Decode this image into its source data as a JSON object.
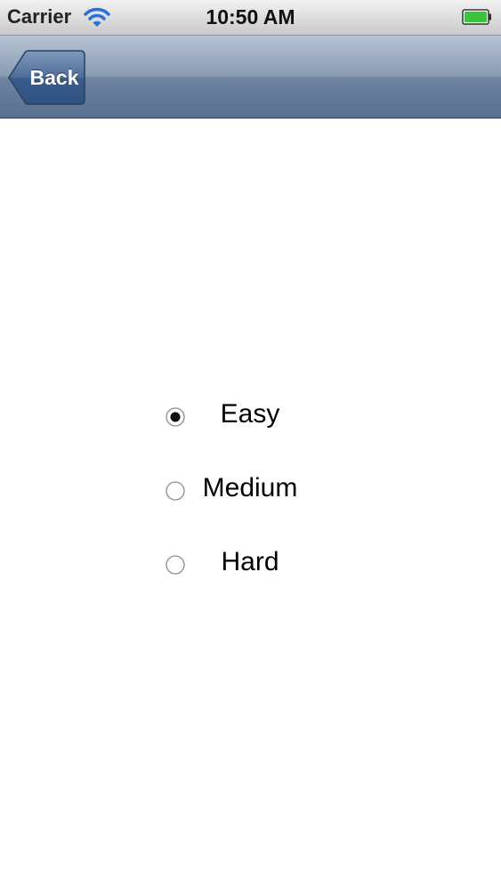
{
  "status_bar": {
    "carrier": "Carrier",
    "time": "10:50 AM",
    "wifi_icon": "wifi-icon",
    "battery_icon": "battery-full-icon",
    "battery_color": "#3cc43c"
  },
  "nav_bar": {
    "back_label": "Back",
    "back_icon": "back-arrow-shape"
  },
  "difficulty": {
    "options": [
      {
        "label": "Easy",
        "selected": true
      },
      {
        "label": "Medium",
        "selected": false
      },
      {
        "label": "Hard",
        "selected": false
      }
    ]
  }
}
